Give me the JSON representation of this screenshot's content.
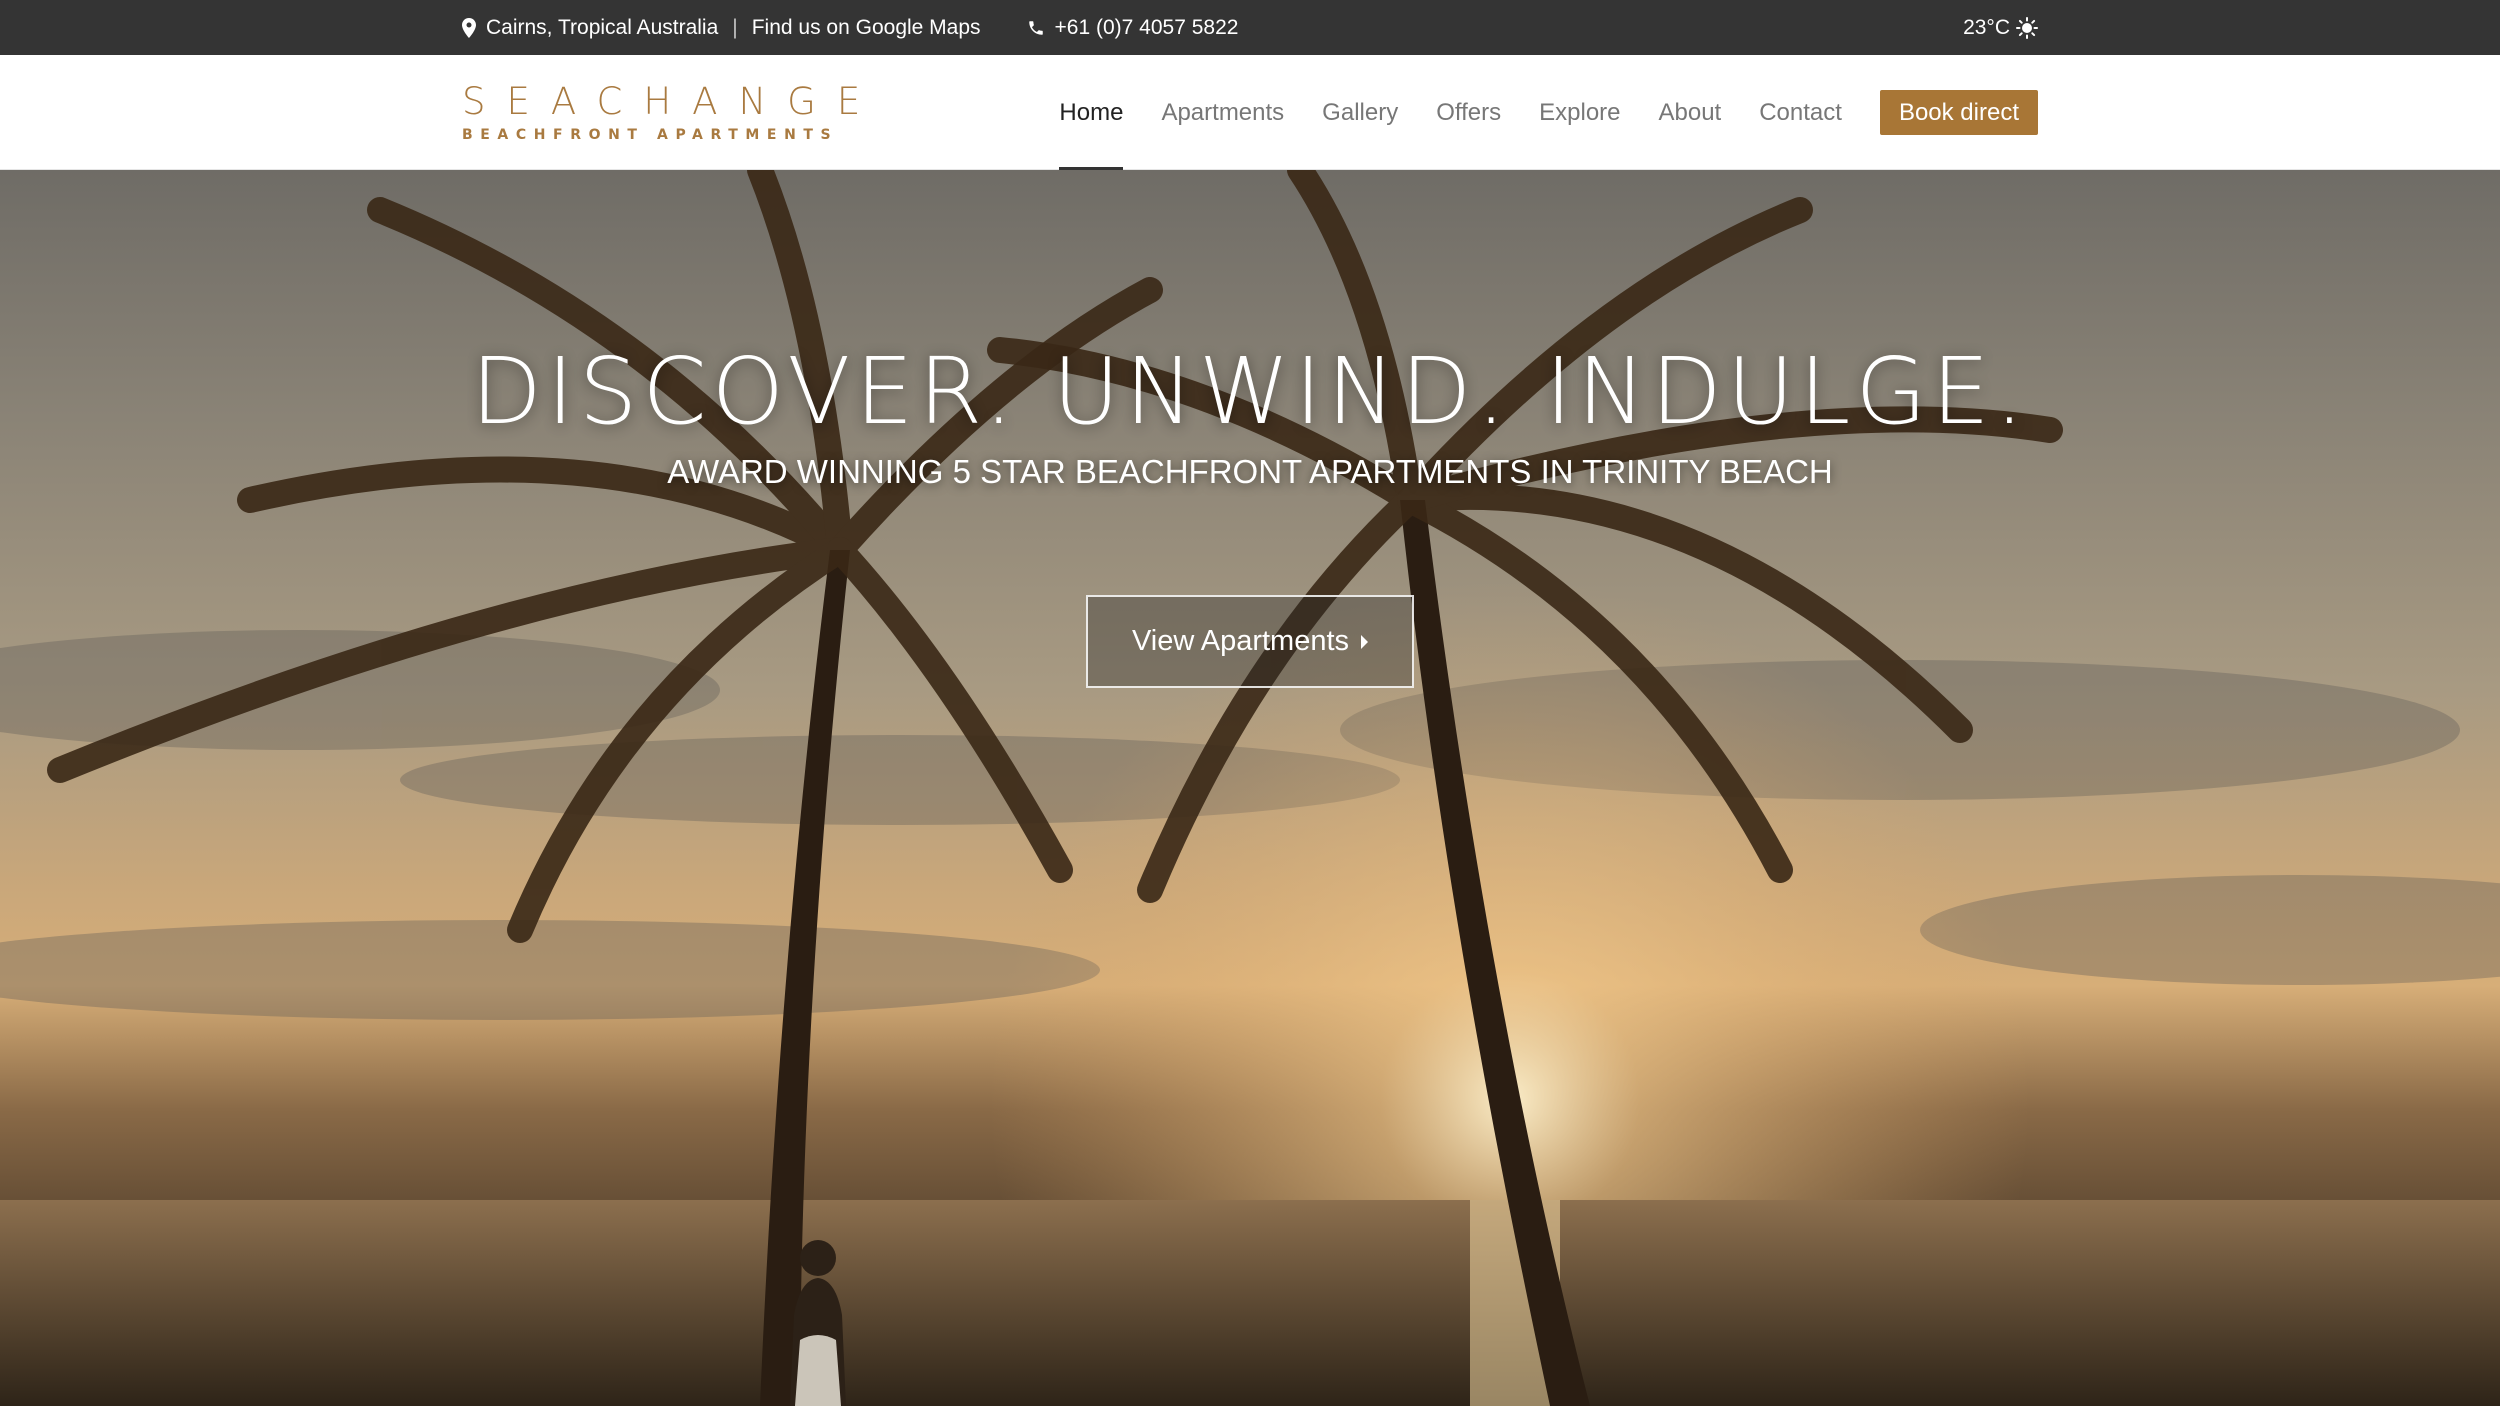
{
  "topbar": {
    "location": "Cairns, Tropical Australia",
    "separator": "|",
    "maps_link": "Find us on Google Maps",
    "phone": "+61 (0)7 4057 5822",
    "weather": "23°C"
  },
  "header": {
    "logo_main": "SEACHANGE",
    "logo_sub": "BEACHFRONT APARTMENTS",
    "nav": [
      {
        "label": "Home",
        "active": true
      },
      {
        "label": "Apartments"
      },
      {
        "label": "Gallery"
      },
      {
        "label": "Offers"
      },
      {
        "label": "Explore"
      },
      {
        "label": "About"
      },
      {
        "label": "Contact"
      }
    ],
    "book_label": "Book direct"
  },
  "hero": {
    "title": "DISCOVER. UNWIND. INDULGE.",
    "subtitle": "AWARD WINNING 5 STAR BEACHFRONT APARTMENTS IN TRINITY BEACH",
    "cta_label": "View Apartments"
  },
  "colors": {
    "accent": "#a87636",
    "logo": "#a97a40",
    "topbar_bg": "#343434"
  },
  "icons": [
    "map-pin-icon",
    "phone-icon",
    "sun-icon",
    "caret-right-icon"
  ]
}
